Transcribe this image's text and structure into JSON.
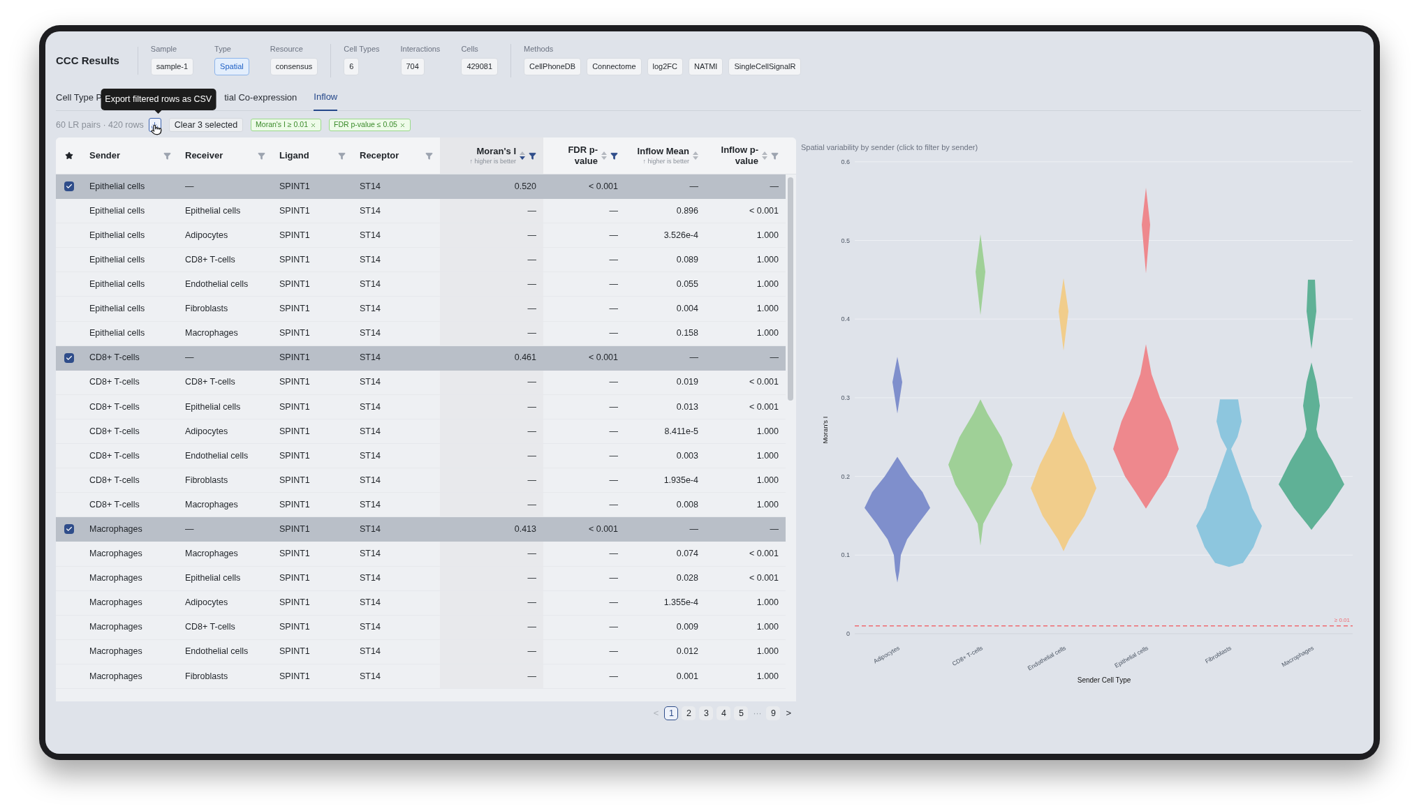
{
  "header": {
    "title": "CCC Results",
    "sections": [
      [
        {
          "label": "Sample",
          "chips": [
            {
              "text": "sample-1",
              "accent": false
            }
          ]
        },
        {
          "label": "Type",
          "chips": [
            {
              "text": "Spatial",
              "accent": true
            }
          ]
        },
        {
          "label": "Resource",
          "chips": [
            {
              "text": "consensus",
              "accent": false
            }
          ]
        }
      ],
      [
        {
          "label": "Cell Types",
          "chips": [
            {
              "text": "6",
              "accent": false
            }
          ]
        },
        {
          "label": "Interactions",
          "chips": [
            {
              "text": "704",
              "accent": false
            }
          ]
        },
        {
          "label": "Cells",
          "chips": [
            {
              "text": "429081",
              "accent": false
            }
          ]
        }
      ],
      [
        {
          "label": "Methods",
          "chips": [
            {
              "text": "CellPhoneDB",
              "accent": false
            },
            {
              "text": "Connectome",
              "accent": false
            },
            {
              "text": "log2FC",
              "accent": false
            },
            {
              "text": "NATMI",
              "accent": false
            },
            {
              "text": "SingleCellSignalR",
              "accent": false
            }
          ]
        }
      ]
    ]
  },
  "tabs": [
    {
      "label": "Cell Type P",
      "selected": false
    },
    {
      "label": "tial Co-expression",
      "selected": false
    },
    {
      "label": "Inflow",
      "selected": true
    }
  ],
  "tooltip": "Export filtered rows as CSV",
  "toolbar": {
    "summary": "60 LR pairs · 420 rows",
    "clear_button": "Clear 3 selected",
    "filters": [
      "Moran's I ≥ 0.01",
      "FDR p-value ≤ 0.05"
    ]
  },
  "table": {
    "columns": [
      {
        "label": "Sender",
        "filtered": false
      },
      {
        "label": "Receiver",
        "filtered": false
      },
      {
        "label": "Ligand",
        "filtered": false
      },
      {
        "label": "Receptor",
        "filtered": false
      },
      {
        "label": "Moran's I",
        "hint": "↑ higher is better",
        "sorted": true,
        "filtered": true
      },
      {
        "label": "FDR p-value",
        "sorted": false,
        "filtered": true
      },
      {
        "label": "Inflow Mean",
        "hint": "↑ higher is better",
        "sorted": false
      },
      {
        "label": "Inflow p-value",
        "sorted": false,
        "filtered": false
      }
    ],
    "rows": [
      {
        "selected": true,
        "cells": [
          "Epithelial cells",
          "—",
          "SPINT1",
          "ST14",
          "0.520",
          "< 0.001",
          "—",
          "—"
        ]
      },
      {
        "selected": false,
        "cells": [
          "Epithelial cells",
          "Epithelial cells",
          "SPINT1",
          "ST14",
          "—",
          "—",
          "0.896",
          "< 0.001"
        ]
      },
      {
        "selected": false,
        "cells": [
          "Epithelial cells",
          "Adipocytes",
          "SPINT1",
          "ST14",
          "—",
          "—",
          "3.526e-4",
          "1.000"
        ]
      },
      {
        "selected": false,
        "cells": [
          "Epithelial cells",
          "CD8+ T-cells",
          "SPINT1",
          "ST14",
          "—",
          "—",
          "0.089",
          "1.000"
        ]
      },
      {
        "selected": false,
        "cells": [
          "Epithelial cells",
          "Endothelial cells",
          "SPINT1",
          "ST14",
          "—",
          "—",
          "0.055",
          "1.000"
        ]
      },
      {
        "selected": false,
        "cells": [
          "Epithelial cells",
          "Fibroblasts",
          "SPINT1",
          "ST14",
          "—",
          "—",
          "0.004",
          "1.000"
        ]
      },
      {
        "selected": false,
        "cells": [
          "Epithelial cells",
          "Macrophages",
          "SPINT1",
          "ST14",
          "—",
          "—",
          "0.158",
          "1.000"
        ]
      },
      {
        "selected": true,
        "cells": [
          "CD8+ T-cells",
          "—",
          "SPINT1",
          "ST14",
          "0.461",
          "< 0.001",
          "—",
          "—"
        ]
      },
      {
        "selected": false,
        "cells": [
          "CD8+ T-cells",
          "CD8+ T-cells",
          "SPINT1",
          "ST14",
          "—",
          "—",
          "0.019",
          "< 0.001"
        ]
      },
      {
        "selected": false,
        "cells": [
          "CD8+ T-cells",
          "Epithelial cells",
          "SPINT1",
          "ST14",
          "—",
          "—",
          "0.013",
          "< 0.001"
        ]
      },
      {
        "selected": false,
        "cells": [
          "CD8+ T-cells",
          "Adipocytes",
          "SPINT1",
          "ST14",
          "—",
          "—",
          "8.411e-5",
          "1.000"
        ]
      },
      {
        "selected": false,
        "cells": [
          "CD8+ T-cells",
          "Endothelial cells",
          "SPINT1",
          "ST14",
          "—",
          "—",
          "0.003",
          "1.000"
        ]
      },
      {
        "selected": false,
        "cells": [
          "CD8+ T-cells",
          "Fibroblasts",
          "SPINT1",
          "ST14",
          "—",
          "—",
          "1.935e-4",
          "1.000"
        ]
      },
      {
        "selected": false,
        "cells": [
          "CD8+ T-cells",
          "Macrophages",
          "SPINT1",
          "ST14",
          "—",
          "—",
          "0.008",
          "1.000"
        ]
      },
      {
        "selected": true,
        "cells": [
          "Macrophages",
          "—",
          "SPINT1",
          "ST14",
          "0.413",
          "< 0.001",
          "—",
          "—"
        ]
      },
      {
        "selected": false,
        "cells": [
          "Macrophages",
          "Macrophages",
          "SPINT1",
          "ST14",
          "—",
          "—",
          "0.074",
          "< 0.001"
        ]
      },
      {
        "selected": false,
        "cells": [
          "Macrophages",
          "Epithelial cells",
          "SPINT1",
          "ST14",
          "—",
          "—",
          "0.028",
          "< 0.001"
        ]
      },
      {
        "selected": false,
        "cells": [
          "Macrophages",
          "Adipocytes",
          "SPINT1",
          "ST14",
          "—",
          "—",
          "1.355e-4",
          "1.000"
        ]
      },
      {
        "selected": false,
        "cells": [
          "Macrophages",
          "CD8+ T-cells",
          "SPINT1",
          "ST14",
          "—",
          "—",
          "0.009",
          "1.000"
        ]
      },
      {
        "selected": false,
        "cells": [
          "Macrophages",
          "Endothelial cells",
          "SPINT1",
          "ST14",
          "—",
          "—",
          "0.012",
          "1.000"
        ]
      },
      {
        "selected": false,
        "cells": [
          "Macrophages",
          "Fibroblasts",
          "SPINT1",
          "ST14",
          "—",
          "—",
          "0.001",
          "1.000"
        ]
      }
    ]
  },
  "pagination": [
    {
      "kind": "prev",
      "text": "<",
      "disabled": true
    },
    {
      "kind": "page",
      "text": "1",
      "selected": true
    },
    {
      "kind": "page",
      "text": "2",
      "selected": false
    },
    {
      "kind": "page",
      "text": "3",
      "selected": false
    },
    {
      "kind": "page",
      "text": "4",
      "selected": false
    },
    {
      "kind": "page",
      "text": "5",
      "selected": false
    },
    {
      "kind": "gap",
      "text": "···"
    },
    {
      "kind": "page",
      "text": "9",
      "selected": false
    },
    {
      "kind": "next",
      "text": ">",
      "disabled": false
    }
  ],
  "violin_plot": {
    "title": "Spatial variability by sender (click to filter by sender)",
    "ylabel": "Moran's I",
    "xlabel": "Sender Cell Type",
    "yticks": [
      "0.6",
      "0.5",
      "0.4",
      "0.3",
      "0.2",
      "0.1",
      "0"
    ],
    "threshold_label": "≥ 0.01",
    "categories": [
      {
        "name": "Adipocytes",
        "color": "#7f8fcc"
      },
      {
        "name": "CD8+ T-cells",
        "color": "#9fd097"
      },
      {
        "name": "Endothelial cells",
        "color": "#f1cd8b"
      },
      {
        "name": "Epithelial cells",
        "color": "#ee888d"
      },
      {
        "name": "Fibroblasts",
        "color": "#8dc6de"
      },
      {
        "name": "Macrophages",
        "color": "#5fb196"
      }
    ]
  }
}
